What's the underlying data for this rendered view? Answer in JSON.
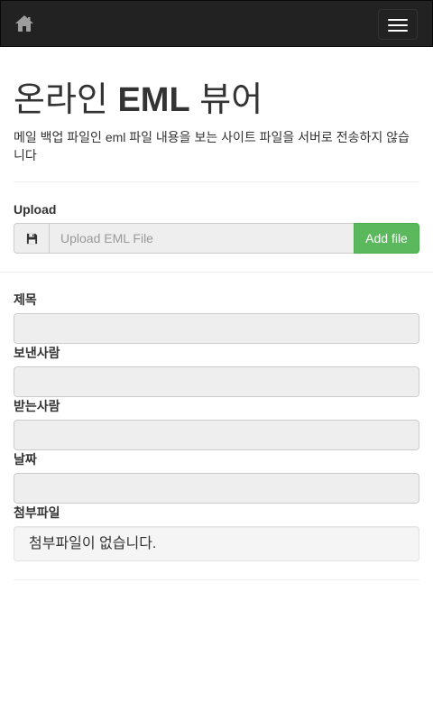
{
  "navbar": {
    "home_icon": "home-icon",
    "toggle_icon": "hamburger-icon"
  },
  "header": {
    "title_prefix": "온라인 ",
    "title_bold": "EML",
    "title_suffix": " 뷰어",
    "subtitle": "메일 백업 파일인 eml 파일 내용을 보는 사이트 파일을 서버로 전송하지 않습니다"
  },
  "upload": {
    "label": "Upload",
    "icon": "floppy-disk-icon",
    "placeholder": "Upload EML File",
    "button_label": "Add file"
  },
  "fields": {
    "subject_label": "제목",
    "sender_label": "보낸사람",
    "recipient_label": "받는사람",
    "date_label": "날짜",
    "attachments_label": "첨부파일",
    "attachments_empty": "첨부파일이 없습니다."
  },
  "colors": {
    "navbar_bg": "#222222",
    "add_button_bg": "#5cb85c",
    "readonly_bg": "#eeeeee"
  }
}
